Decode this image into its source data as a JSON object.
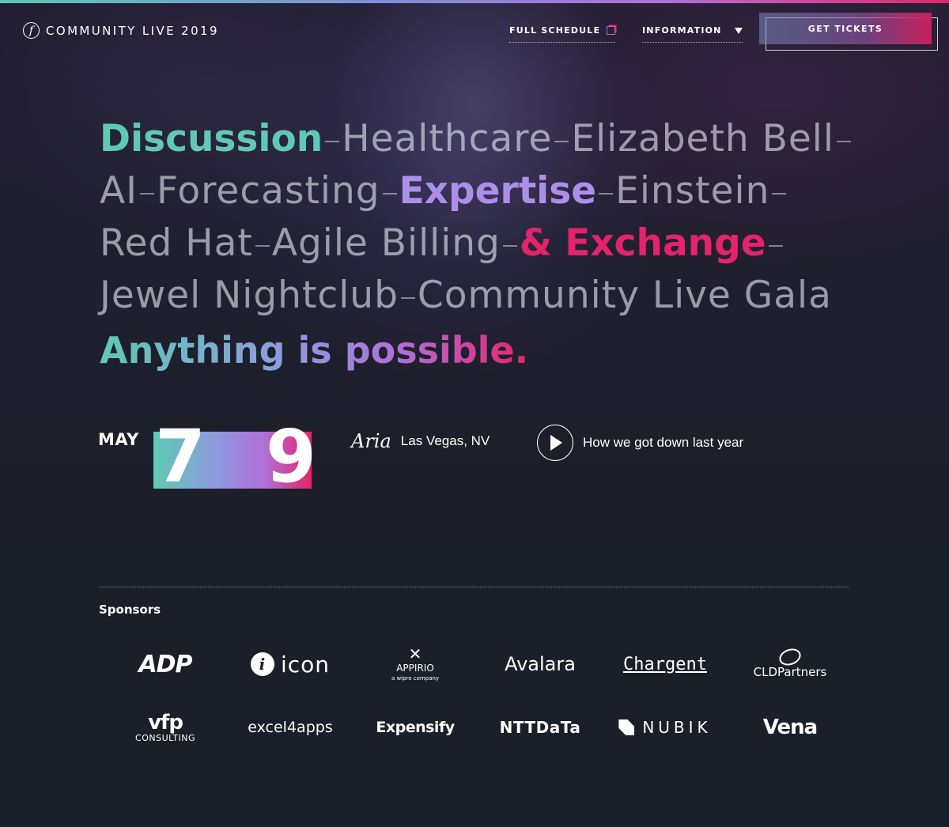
{
  "header": {
    "logo_text": "COMMUNITY LIVE 2019",
    "nav": {
      "full_schedule": "FULL SCHEDULE",
      "information": "INFORMATION"
    },
    "tickets_label": "GET TICKETS"
  },
  "hero": {
    "line1": [
      "Discussion",
      "Healthcare",
      "Elizabeth Bell"
    ],
    "line2": [
      "AI",
      "Forecasting",
      "Expertise",
      "Einstein"
    ],
    "line3": [
      "Red Hat",
      "Agile Billing",
      "& Exchange"
    ],
    "line4": [
      "Jewel Nightclub",
      "Community Live Gala"
    ],
    "tagline": "Anything is possible."
  },
  "event": {
    "month": "MAY",
    "day_start": "7",
    "day_end": "9",
    "venue_logo": "Aria",
    "city": "Las Vegas, NV",
    "video_label": "How we got down last year"
  },
  "sponsors": {
    "title": "Sponsors",
    "items": [
      {
        "name": "ADP"
      },
      {
        "name": "icon"
      },
      {
        "name": "APPIRIO",
        "sub": "a wipro company"
      },
      {
        "name": "Avalara"
      },
      {
        "name": "Chargent"
      },
      {
        "name": "CLDPartners"
      },
      {
        "name": "vfp",
        "sub": "CONSULTING"
      },
      {
        "name": "excel4apps"
      },
      {
        "name": "Expensify"
      },
      {
        "name": "NTTDaTa"
      },
      {
        "name": "NUBIK"
      },
      {
        "name": "Vena"
      }
    ]
  },
  "colors": {
    "accent_green": "#5ecab3",
    "accent_purple": "#ad8fea",
    "accent_pink": "#e4236a",
    "background": "#1b1f29"
  },
  "icons": [
    "logo-mark-icon",
    "schedule-square-icon",
    "dropdown-triangle-icon",
    "play-icon"
  ]
}
